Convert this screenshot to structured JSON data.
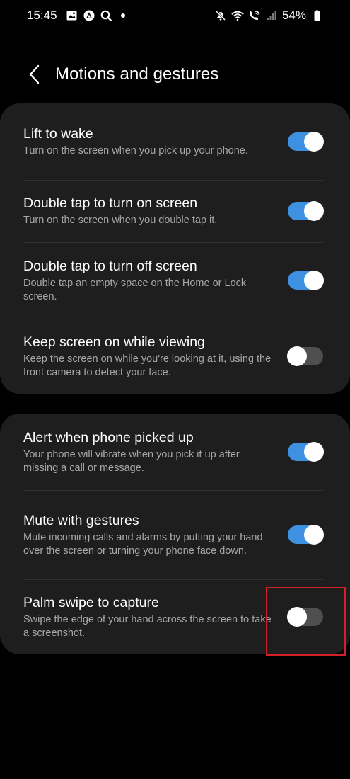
{
  "status_bar": {
    "time": "15:45",
    "battery": "54%",
    "left_icons": [
      "image-icon",
      "assistant-icon",
      "search-icon",
      "dot-icon"
    ],
    "right_icons": [
      "mute-icon",
      "wifi-icon",
      "wifi-call-icon",
      "signal-icon"
    ]
  },
  "header": {
    "title": "Motions and gestures",
    "back_icon": "chevron-left-icon"
  },
  "accent_color": "#3e91e0",
  "highlight_color": "#d1202a",
  "group1": [
    {
      "title": "Lift to wake",
      "subtitle": "Turn on the screen when you pick up your phone.",
      "enabled": true
    },
    {
      "title": "Double tap to turn on screen",
      "subtitle": "Turn on the screen when you double tap it.",
      "enabled": true
    },
    {
      "title": "Double tap to turn off screen",
      "subtitle": "Double tap an empty space on the Home or Lock screen.",
      "enabled": true
    },
    {
      "title": "Keep screen on while viewing",
      "subtitle": "Keep the screen on while you're looking at it, using the front camera to detect your face.",
      "enabled": false
    }
  ],
  "group2": [
    {
      "title": "Alert when phone picked up",
      "subtitle": "Your phone will vibrate when you pick it up after missing a call or message.",
      "enabled": true
    },
    {
      "title": "Mute with gestures",
      "subtitle": "Mute incoming calls and alarms by putting your hand over the screen or turning your phone face down.",
      "enabled": true
    },
    {
      "title": "Palm swipe to capture",
      "subtitle": "Swipe the edge of your hand across the screen to take a screenshot.",
      "enabled": false
    }
  ]
}
